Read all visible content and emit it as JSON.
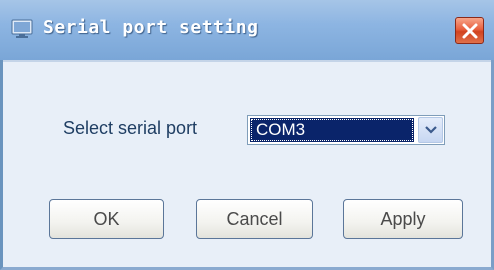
{
  "window": {
    "title": "Serial port setting",
    "icon": "monitor-icon",
    "close_icon": "close-icon",
    "colors": {
      "titlebar": "#8db5e2",
      "client": "#e8eff8",
      "close_button": "#e8603f",
      "selection": "#0a246a"
    }
  },
  "form": {
    "serial_port_label": "Select serial port",
    "serial_port_value": "COM3",
    "dropdown_icon": "chevron-down-icon"
  },
  "buttons": {
    "ok": "OK",
    "cancel": "Cancel",
    "apply": "Apply"
  }
}
